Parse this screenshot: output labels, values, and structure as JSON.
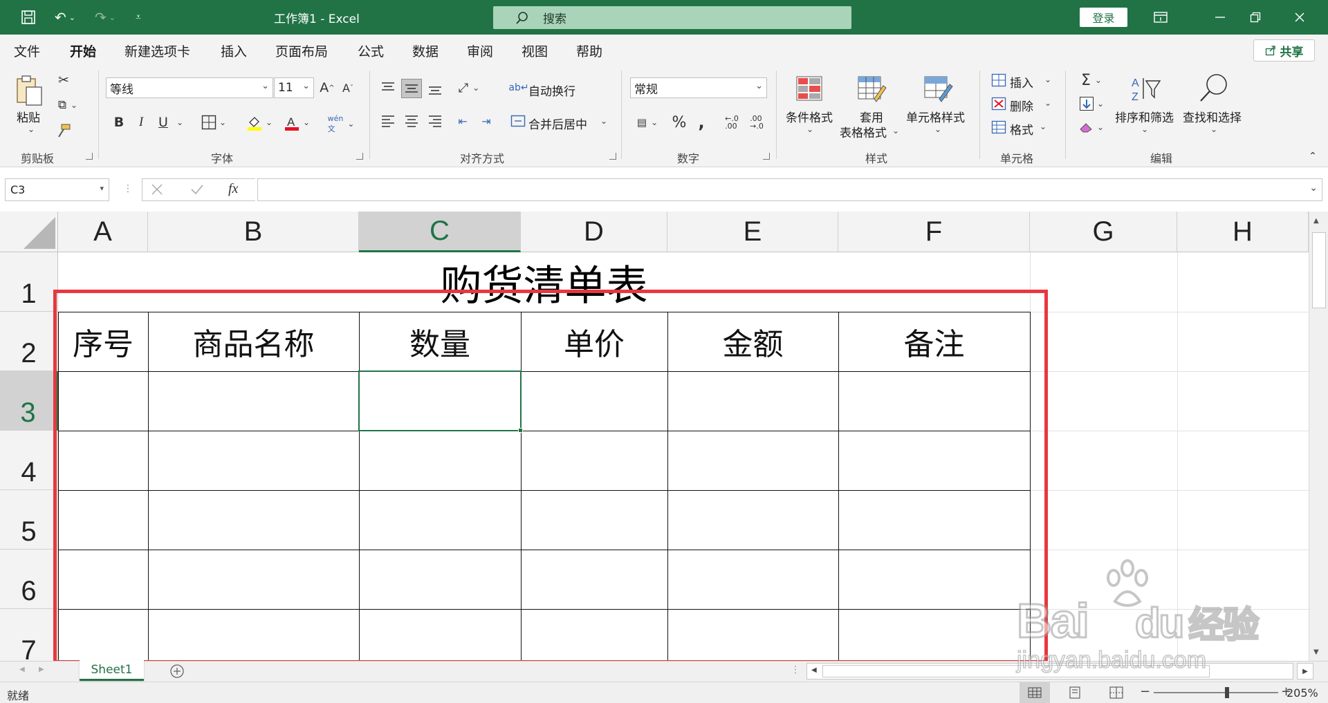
{
  "titlebar": {
    "title": "工作簿1  -  Excel",
    "search_placeholder": "搜索",
    "login_label": "登录"
  },
  "menu": {
    "tabs": [
      "文件",
      "开始",
      "新建选项卡",
      "插入",
      "页面布局",
      "公式",
      "数据",
      "审阅",
      "视图",
      "帮助"
    ],
    "active": "开始",
    "share_label": "共享"
  },
  "ribbon": {
    "clipboard": {
      "paste_label": "粘贴",
      "group_label": "剪贴板"
    },
    "font": {
      "font_name": "等线",
      "font_size": "11",
      "group_label": "字体",
      "bold": "B",
      "italic": "I",
      "underline": "U"
    },
    "alignment": {
      "wrap_label": "自动换行",
      "merge_label": "合并后居中",
      "group_label": "对齐方式"
    },
    "number": {
      "format": "常规",
      "group_label": "数字"
    },
    "styles": {
      "conditional_label": "条件格式",
      "table_label_1": "套用",
      "table_label_2": "表格格式",
      "cell_styles_label": "单元格样式",
      "group_label": "样式"
    },
    "cells": {
      "insert_label": "插入",
      "delete_label": "删除",
      "format_label": "格式",
      "group_label": "单元格"
    },
    "editing": {
      "sort_label": "排序和筛选",
      "find_label": "查找和选择",
      "group_label": "编辑"
    }
  },
  "formula": {
    "name_box": "C3",
    "fx": "fx",
    "value": ""
  },
  "grid": {
    "columns": [
      "A",
      "B",
      "C",
      "D",
      "E",
      "F",
      "G",
      "H"
    ],
    "rows": [
      "1",
      "2",
      "3",
      "4",
      "5",
      "6",
      "7"
    ],
    "selected_column": "C",
    "selected_row": "3",
    "title": "购货清单表",
    "headers": [
      "序号",
      "商品名称",
      "数量",
      "单价",
      "金额",
      "备注"
    ]
  },
  "sheets": {
    "tabs": [
      "Sheet1"
    ],
    "active": "Sheet1"
  },
  "status": {
    "ready": "就绪",
    "zoom": "205%"
  },
  "watermark": {
    "brand_text": "Bai",
    "brand_text_2": "du",
    "brand_text_3": "经验",
    "url": "jingyan.baidu.com"
  },
  "colors": {
    "excel_green": "#217346",
    "annotation_red": "#e8373f"
  }
}
